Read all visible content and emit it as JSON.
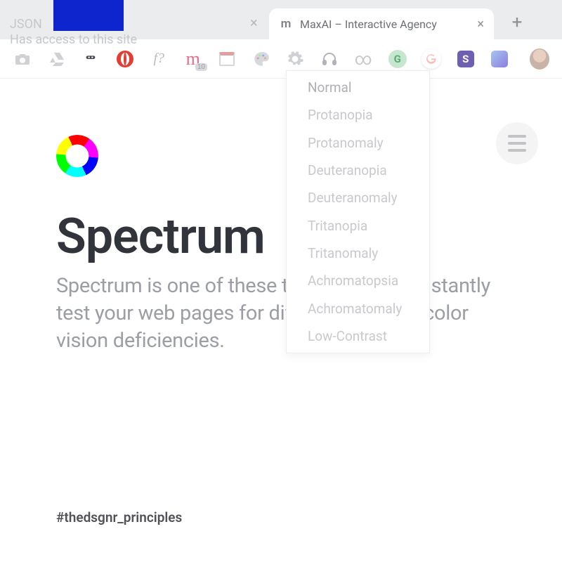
{
  "tabs": {
    "active": {
      "title": "MaxAI – Interactive Agency",
      "icon_letter": "m"
    }
  },
  "ext_popup": {
    "line1": "JSON",
    "line2": "Has access to this site"
  },
  "toolbar": {
    "m_badge": "10",
    "grammarly_letter": "G",
    "square_letter": "S"
  },
  "dropdown": {
    "items": [
      "Normal",
      "Protanopia",
      "Protanomaly",
      "Deuteranopia",
      "Deuteranomaly",
      "Tritanopia",
      "Tritanomaly",
      "Achromatopsia",
      "Achromatomaly",
      "Low-Contrast"
    ]
  },
  "page": {
    "title": "Spectrum",
    "description": "Spectrum is one of these tools—you can instantly test your web pages for different kinds of color vision deficiencies.",
    "hashtag": "#thedsgnr_principles"
  }
}
